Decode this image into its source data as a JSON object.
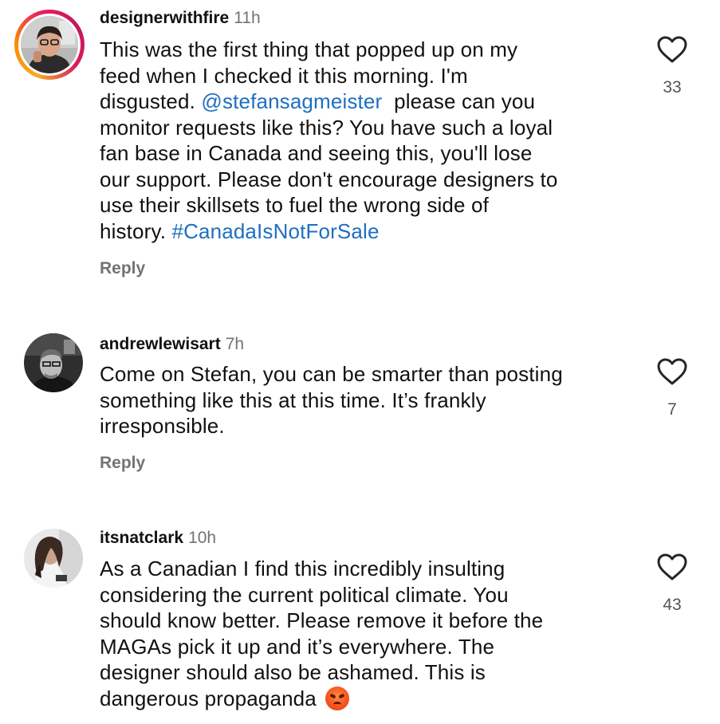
{
  "comments": [
    {
      "username": "designerwithfire",
      "time": "11h",
      "has_story_ring": true,
      "lines": [
        "This was the first thing that popped up on my",
        "feed when I checked it this morning. I'm"
      ],
      "line3_pre": "disgusted. ",
      "mention": "@stefansagmeister",
      "line3_post": "  please can you",
      "lines_after": [
        "monitor requests like this? You have such a loyal",
        "fan base in Canada and seeing this, you'll lose",
        "our support. Please don't encourage designers to",
        "use their skillsets to fuel the wrong side of"
      ],
      "last_pre": "history. ",
      "hashtag": "#CanadaIsNotForSale",
      "reply_label": "Reply",
      "like_count": "33"
    },
    {
      "username": "andrewlewisart",
      "time": "7h",
      "lines": [
        "Come on Stefan, you can be smarter than posting",
        "something like this at this time. It’s frankly",
        "irresponsible."
      ],
      "reply_label": "Reply",
      "like_count": "7"
    },
    {
      "username": "itsnatclark",
      "time": "10h",
      "lines": [
        "As a Canadian I find this incredibly insulting",
        "considering the current political climate. You",
        "should know better. Please remove it before the",
        "MAGAs pick it up and it’s everywhere. The",
        "designer should also be ashamed. This is"
      ],
      "last_pre": "dangerous propaganda",
      "emoji": "angry-face-emoji",
      "like_count": "43"
    }
  ],
  "colors": {
    "link": "#1e6fc0",
    "secondary_text": "#737373",
    "primary_text": "#111111"
  },
  "icons": {
    "like": "heart-outline-icon"
  }
}
